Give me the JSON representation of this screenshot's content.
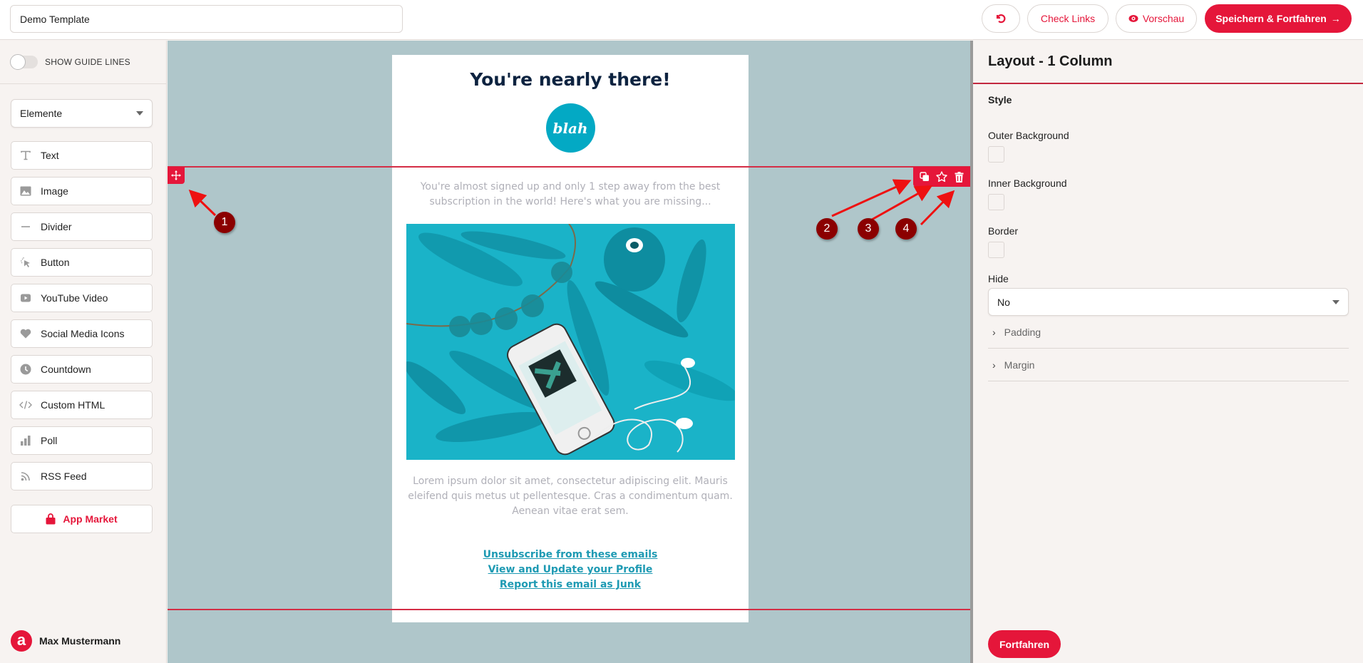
{
  "header": {
    "template_name": "Demo Template",
    "undo_icon": "undo-icon",
    "check_links_label": "Check Links",
    "preview_label": "Vorschau",
    "preview_icon": "eye-icon",
    "save_label": "Speichern & Fortfahren",
    "save_icon": "arrow-right-icon"
  },
  "sidebar": {
    "guide_lines_label": "SHOW GUIDE LINES",
    "guide_lines_on": false,
    "category_select": "Elemente",
    "elements": [
      {
        "label": "Text",
        "icon": "text-icon"
      },
      {
        "label": "Image",
        "icon": "image-icon"
      },
      {
        "label": "Divider",
        "icon": "divider-icon"
      },
      {
        "label": "Button",
        "icon": "pointer-click-icon"
      },
      {
        "label": "YouTube Video",
        "icon": "video-icon"
      },
      {
        "label": "Social Media Icons",
        "icon": "heart-icon"
      },
      {
        "label": "Countdown",
        "icon": "clock-icon"
      },
      {
        "label": "Custom HTML",
        "icon": "code-icon"
      },
      {
        "label": "Poll",
        "icon": "bar-chart-icon"
      },
      {
        "label": "RSS Feed",
        "icon": "rss-icon"
      }
    ],
    "app_market_label": "App Market",
    "user_name": "Max Mustermann"
  },
  "email": {
    "heading": "You're nearly there!",
    "logo_text": "blah",
    "intro": "You're almost signed up and only 1 step away from the best subscription in the world! Here's what you are missing...",
    "body": "Lorem ipsum dolor sit amet, consectetur adipiscing elit. Mauris eleifend quis metus ut pellentesque. Cras a condimentum quam. Aenean vitae erat sem.",
    "links": [
      "Unsubscribe from these emails",
      "View and Update your Profile",
      "Report this email as Junk"
    ]
  },
  "annotations": [
    "1",
    "2",
    "3",
    "4"
  ],
  "colors": {
    "accent": "#e5163a",
    "canvas_bg": "#afc6ca",
    "link": "#1e9ab3",
    "heading": "#0d2340",
    "badge": "#8b0000"
  },
  "panel": {
    "title": "Layout - 1 Column",
    "style_label": "Style",
    "outer_bg_label": "Outer Background",
    "inner_bg_label": "Inner Background",
    "border_label": "Border",
    "hide_label": "Hide",
    "hide_value": "No",
    "padding_label": "Padding",
    "margin_label": "Margin",
    "continue_label": "Fortfahren"
  }
}
